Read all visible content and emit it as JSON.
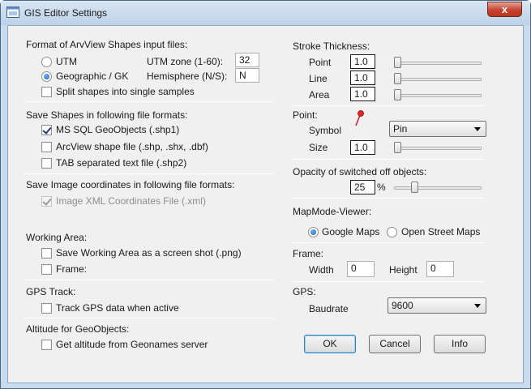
{
  "window": {
    "title": "GIS Editor Settings",
    "close_label": "x"
  },
  "shapes_input": {
    "heading": "Format of ArvView Shapes input files:",
    "utm_label": "UTM",
    "geographic_label": "Geographic / GK",
    "utm_zone_label": "UTM zone (1-60):",
    "utm_zone_value": "32",
    "hemisphere_label": "Hemisphere (N/S):",
    "hemisphere_value": "N",
    "split_label": "Split shapes into single samples",
    "selected": "geographic"
  },
  "save_shapes": {
    "heading": "Save Shapes in following file formats:",
    "ms_sql_label": "MS SQL GeoObjects (.shp1)",
    "arcview_label": "ArcView shape file (.shp, .shx, .dbf)",
    "tab_label": "TAB separated text file (.shp2)"
  },
  "save_image": {
    "heading": "Save Image coordinates in following file formats:",
    "xml_label": "Image XML Coordinates File (.xml)"
  },
  "working_area": {
    "heading": "Working Area:",
    "screenshot_label": "Save Working Area as a screen shot (.png)",
    "frame_label": "Frame:"
  },
  "gps_track": {
    "heading": "GPS Track:",
    "track_label": "Track GPS data when active"
  },
  "altitude": {
    "heading": "Altitude for GeoObjects:",
    "geonames_label": "Get altitude from Geonames server"
  },
  "stroke": {
    "heading": "Stroke Thickness:",
    "point_label": "Point",
    "point_value": "1.0",
    "line_label": "Line",
    "line_value": "1.0",
    "area_label": "Area",
    "area_value": "1.0"
  },
  "point": {
    "heading": "Point:",
    "symbol_label": "Symbol",
    "symbol_value": "Pin",
    "size_label": "Size",
    "size_value": "1.0"
  },
  "opacity": {
    "heading": "Opacity of switched off objects:",
    "value": "25",
    "unit": "%"
  },
  "mapmode": {
    "heading": "MapMode-Viewer:",
    "google_label": "Google Maps",
    "osm_label": "Open Street Maps",
    "selected": "google"
  },
  "frame": {
    "heading": "Frame:",
    "width_label": "Width",
    "width_value": "0",
    "height_label": "Height",
    "height_value": "0"
  },
  "gps": {
    "heading": "GPS:",
    "baudrate_label": "Baudrate",
    "baudrate_value": "9600"
  },
  "buttons": {
    "ok": "OK",
    "cancel": "Cancel",
    "info": "Info"
  },
  "colors": {
    "titlebar": "#c9dcee",
    "close": "#c7432f",
    "pin": "#d02020"
  }
}
